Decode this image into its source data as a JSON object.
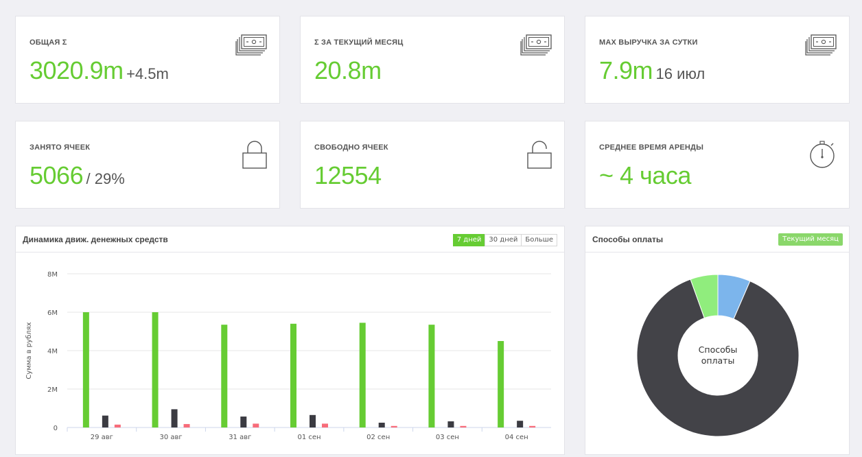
{
  "stats": [
    {
      "title": "ОБЩАЯ Σ",
      "value": "3020.9m",
      "suffix": "+4.5m",
      "icon": "money-icon"
    },
    {
      "title": "Σ ЗА ТЕКУЩИЙ МЕСЯЦ",
      "value": "20.8m",
      "suffix": "",
      "icon": "money-icon"
    },
    {
      "title": "MAX ВЫРУЧКА ЗА СУТКИ",
      "value": "7.9m",
      "suffix": "16 июл",
      "icon": "money-icon"
    },
    {
      "title": "ЗАНЯТО ЯЧЕЕК",
      "value": "5066",
      "suffix": "/ 29%",
      "icon": "lock-closed-icon"
    },
    {
      "title": "СВОБОДНО ЯЧЕЕК",
      "value": "12554",
      "suffix": "",
      "icon": "lock-open-icon"
    },
    {
      "title": "СРЕДНЕЕ ВРЕМЯ АРЕНДЫ",
      "value": "~ 4 часа",
      "suffix": "",
      "icon": "stopwatch-icon"
    }
  ],
  "cashflow": {
    "title": "Динамика движ. денежных средств",
    "ranges": [
      "7 дней",
      "30 дней",
      "Больше"
    ],
    "active_range": "7 дней"
  },
  "payments": {
    "title": "Способы оплаты",
    "filter": "Текущий месяц",
    "center_label": [
      "Способы",
      "оплаты"
    ]
  },
  "colors": {
    "accent": "#66cc33",
    "series_green": "#66cc33",
    "series_dark": "#3b3b42",
    "series_red": "#f76c7a",
    "pie_dark": "#434348",
    "pie_blue": "#7cb5ec",
    "pie_green": "#90ed7d"
  },
  "chart_data": [
    {
      "type": "bar",
      "categories": [
        "29 авг",
        "30 авг",
        "31 авг",
        "01 сен",
        "02 сен",
        "03 сен",
        "04 сен"
      ],
      "series": [
        {
          "values": [
            6.0,
            6.0,
            5.35,
            5.4,
            5.45,
            5.35,
            4.5
          ]
        },
        {
          "values": [
            0.62,
            0.95,
            0.57,
            0.65,
            0.25,
            0.32,
            0.35
          ]
        },
        {
          "values": [
            0.15,
            0.18,
            0.2,
            0.2,
            0.08,
            0.08,
            0.08
          ]
        }
      ],
      "yticks": [
        "0",
        "2M",
        "4M",
        "6M",
        "8M"
      ],
      "ylabel": "Сумма в рублях",
      "ylim": [
        0,
        8
      ],
      "grid": true
    },
    {
      "type": "pie",
      "labels": [],
      "values": [
        88,
        6.5,
        5.5
      ],
      "slice_colors": [
        "#434348",
        "#7cb5ec",
        "#90ed7d"
      ],
      "donut": true
    }
  ]
}
